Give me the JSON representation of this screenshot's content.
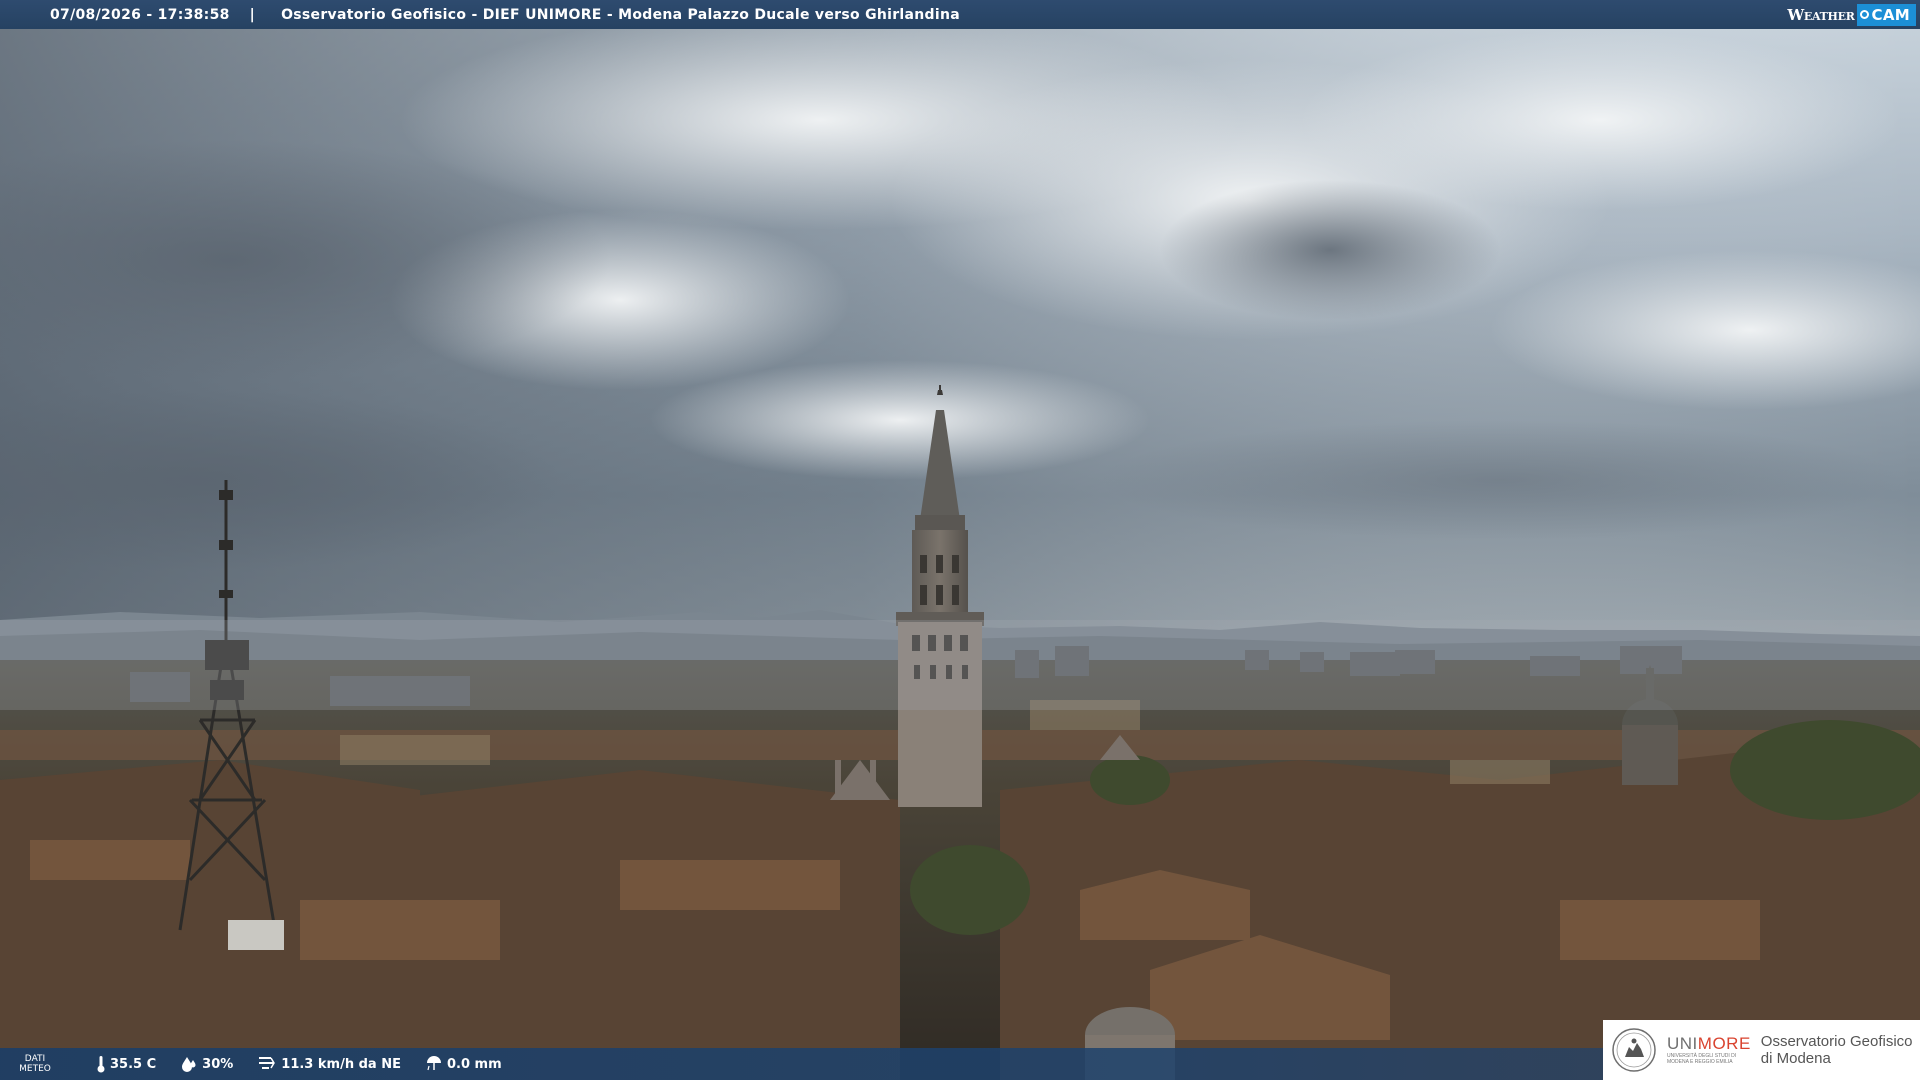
{
  "topbar": {
    "timestamp": "07/08/2026 - 17:38:58",
    "separator": "|",
    "location": "Osservatorio Geofisico - DIEF UNIMORE - Modena Palazzo Ducale verso Ghirlandina",
    "logo_weather": "Weather",
    "logo_cam": "CAM"
  },
  "weather_data": {
    "label_line1": "DATI",
    "label_line2": "METEO",
    "temperature": "35.5 C",
    "humidity": "30%",
    "wind": "11.3 km/h da NE",
    "rain": "0.0 mm"
  },
  "logo_panel": {
    "brand_uni": "UNI",
    "brand_more": "MORE",
    "brand_subtitle_1": "UNIVERSITÀ DEGLI STUDI DI",
    "brand_subtitle_2": "MODENA E REGGIO EMILIA",
    "observatory_line1": "Osservatorio Geofisico",
    "observatory_line2": "di Modena"
  },
  "colors": {
    "bar_blue": "#264262",
    "cam_blue": "#1c8fd6",
    "unimore_red": "#d9432f"
  },
  "icons": [
    "thermometer-icon",
    "humidity-icon",
    "wind-icon",
    "rain-gauge-icon",
    "university-seal-icon",
    "camera-lens-icon"
  ]
}
